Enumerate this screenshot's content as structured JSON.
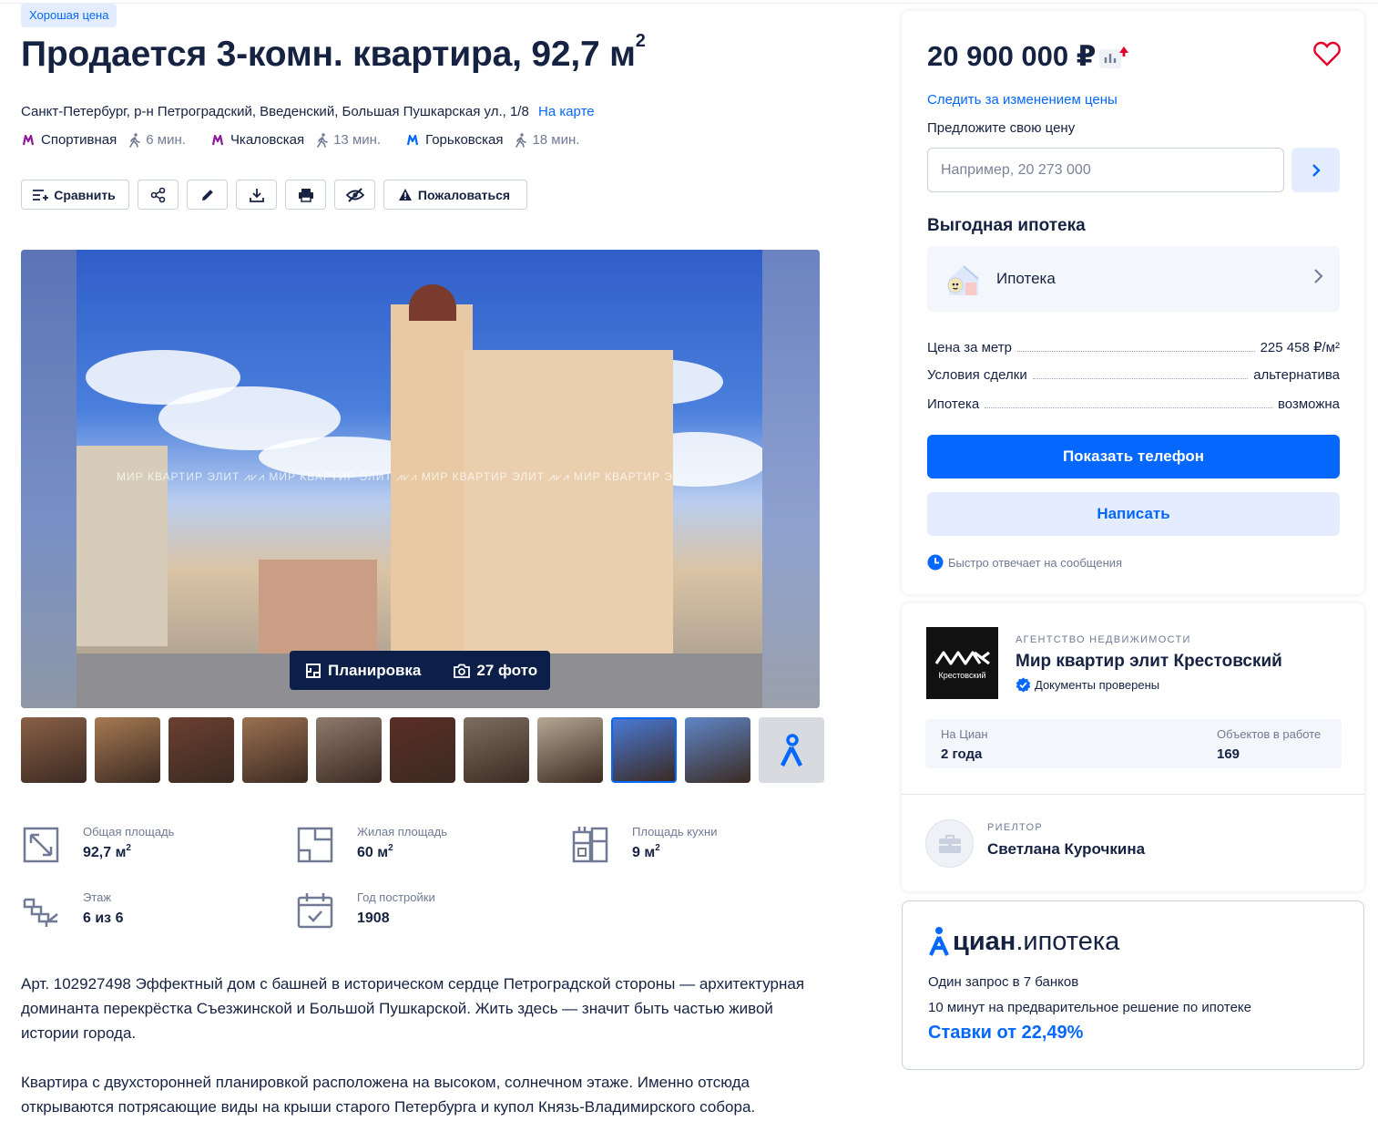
{
  "badge": "Хорошая цена",
  "title": {
    "main": "Продается 3-комн. квартира, 92,7 м",
    "sup": "2"
  },
  "address": {
    "text": "Санкт-Петербург, р-н Петроградский, Введенский, Большая Пушкарская ул., 1/8",
    "map_link": "На карте"
  },
  "metros": [
    {
      "name": "Спортивная",
      "time": "6 мин.",
      "color": "#8e1b9b"
    },
    {
      "name": "Чкаловская",
      "time": "13 мин.",
      "color": "#8e1b9b"
    },
    {
      "name": "Горьковская",
      "time": "18 мин.",
      "color": "#0468ff"
    }
  ],
  "toolbar": {
    "compare": "Сравнить",
    "complain": "Пожаловаться",
    "icons": [
      "share-icon",
      "edit-icon",
      "download-icon",
      "print-icon",
      "hide-icon"
    ]
  },
  "gallery": {
    "watermark": "МИР КВАРТИР ЭЛИТ  ⩘⩗⩘  МИР КВАРТИР ЭЛИТ  ⩘⩗⩘  МИР КВАРТИР ЭЛИТ  ⩘⩗⩘  МИР КВАРТИР Э",
    "plan": "Планировка",
    "photos": "27 фото"
  },
  "thumbnails": {
    "colors": [
      "#8a6046",
      "#a77a52",
      "#6b4030",
      "#9b7050",
      "#8c7a6c",
      "#5a2e26",
      "#7e6e60",
      "#b4a893",
      "#4a79d6",
      "#5f86c8"
    ],
    "active_index": 8
  },
  "features": [
    {
      "label": "Общая площадь",
      "value": "92,7 м",
      "sup": "2",
      "icon": "total-area-icon"
    },
    {
      "label": "Жилая площадь",
      "value": "60 м",
      "sup": "2",
      "icon": "living-area-icon"
    },
    {
      "label": "Площадь кухни",
      "value": "9 м",
      "sup": "2",
      "icon": "kitchen-icon"
    },
    {
      "label": "Этаж",
      "value": "6 из 6",
      "sup": "",
      "icon": "stairs-icon"
    },
    {
      "label": "Год постройки",
      "value": "1908",
      "sup": "",
      "icon": "calendar-icon"
    }
  ],
  "description": [
    "Арт. 102927498 Эффектный дом с башней в историческом сердце Петроградской стороны — архитектурная доминанта перекрёстка Съезжинской и Большой Пушкарской. Жить здесь — значит быть частью живой истории города.",
    "Квартира с двухсторонней планировкой расположена на высоком, солнечном этаже. Именно отсюда открываются потрясающие виды на крыши старого Петербурга и купол Князь-Владимирского собора."
  ],
  "price_card": {
    "price": "20 900 000 ₽",
    "track_price": "Следить за изменением цены",
    "offer_label": "Предложите свою цену",
    "offer_placeholder": "Например, 20 273 000",
    "mortgage_title": "Выгодная ипотека",
    "mortgage_row": "Ипотека",
    "info": [
      {
        "label": "Цена за метр",
        "value": "225 458 ₽/м²"
      },
      {
        "label": "Условия сделки",
        "value": "альтернатива"
      },
      {
        "label": "Ипотека",
        "value": "возможна"
      }
    ],
    "show_phone": "Показать телефон",
    "write": "Написать",
    "fast_reply": "Быстро отвечает на сообщения"
  },
  "agency": {
    "logo_sub": "Крестовский",
    "kind": "АГЕНТСТВО НЕДВИЖИМОСТИ",
    "name": "Мир квартир элит Крестовский",
    "verified": "Документы проверены",
    "stats": [
      {
        "label": "На Циан",
        "value": "2 года"
      },
      {
        "label": "Объектов в работе",
        "value": "169"
      }
    ],
    "realtor_kind": "РИЕЛТОР",
    "realtor_name": "Светлана Курочкина"
  },
  "cian_mortgage": {
    "logo_main": "циан",
    "logo_sub": ".ипотека",
    "line1": "Один запрос в 7 банков",
    "line2": "10 минут на предварительное решение по ипотеке",
    "rate": "Ставки от 22,49%"
  },
  "colors": {
    "accent": "#0468ff",
    "text": "#152242",
    "muted": "#707a95",
    "favorite": "#e4002b"
  }
}
